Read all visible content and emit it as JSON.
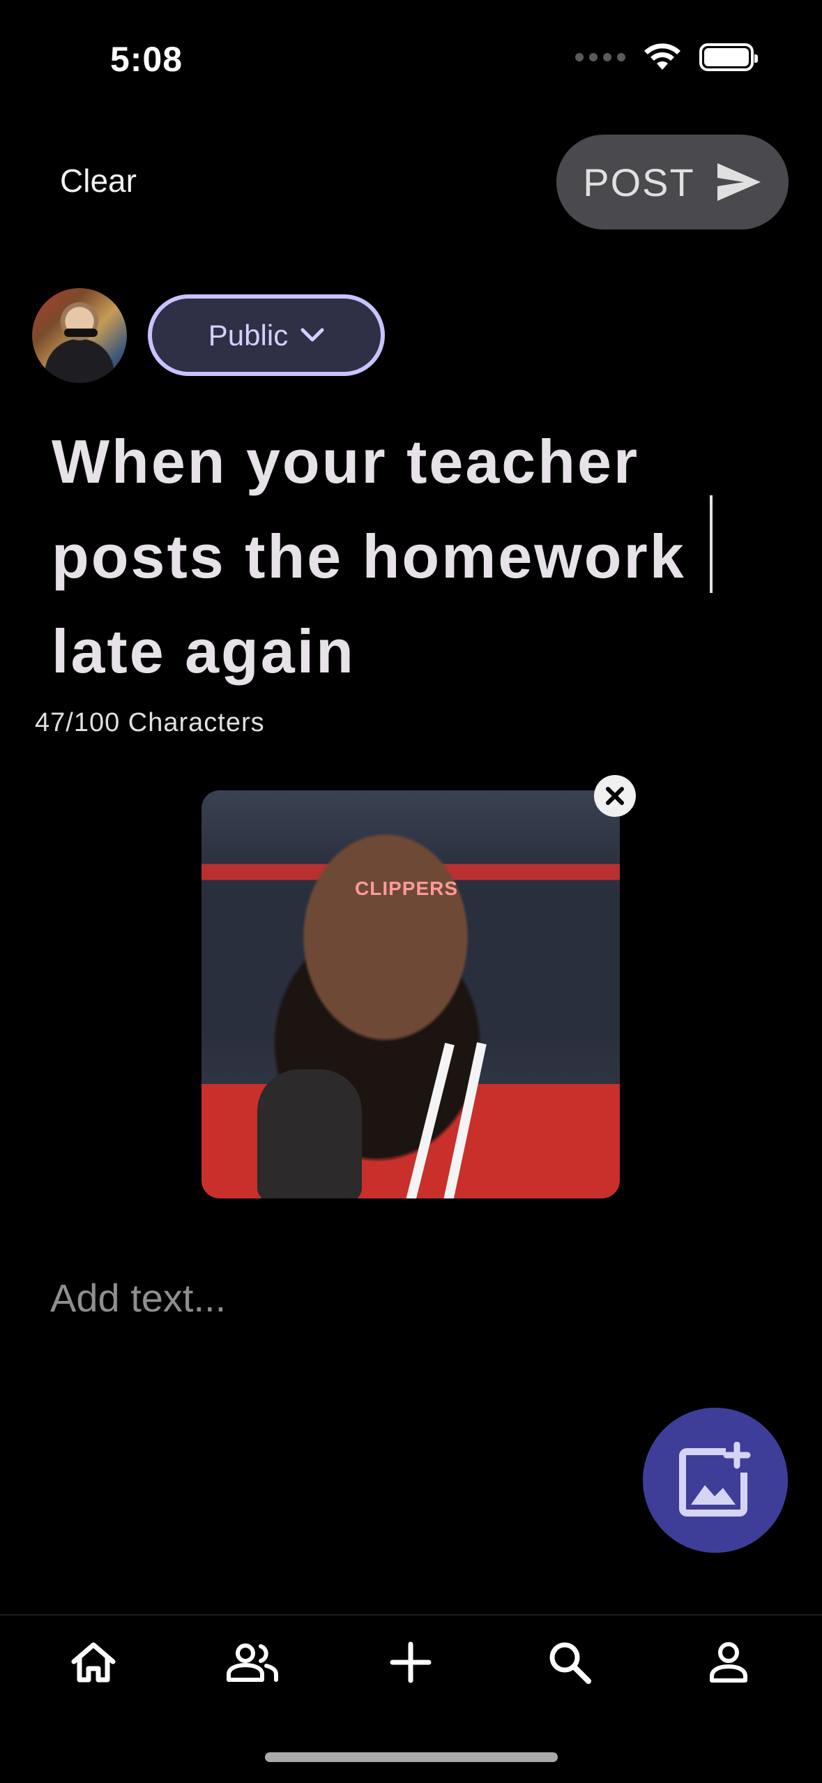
{
  "status_bar": {
    "time": "5:08"
  },
  "header": {
    "clear_label": "Clear",
    "post_label": "POST"
  },
  "author": {
    "visibility_label": "Public"
  },
  "post": {
    "title": "When your teacher posts the homework late again",
    "char_count": "47/100 Characters",
    "body_placeholder": "Add text..."
  },
  "media": {
    "banner_text": "CLIPPERS"
  },
  "colors": {
    "background": "#000000",
    "post_button": "#4a4a4e",
    "visibility_border": "#c8c3ff",
    "visibility_fill": "#2f2f45",
    "fab": "#3e3e99"
  },
  "nav": {
    "items": [
      {
        "icon": "home-icon"
      },
      {
        "icon": "people-icon"
      },
      {
        "icon": "plus-icon"
      },
      {
        "icon": "search-icon"
      },
      {
        "icon": "profile-icon"
      }
    ]
  }
}
